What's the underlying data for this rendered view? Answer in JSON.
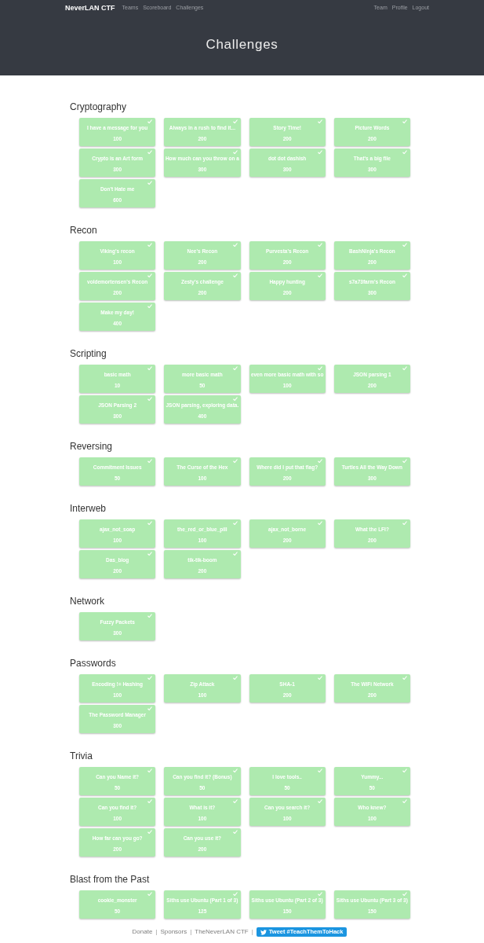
{
  "navbar": {
    "brand": "NeverLAN CTF",
    "left_links": [
      "Teams",
      "Scoreboard",
      "Challenges"
    ],
    "right_links": [
      "Team",
      "Profile",
      "Logout"
    ]
  },
  "header": {
    "title": "Challenges"
  },
  "categories": [
    {
      "name": "Cryptography",
      "challenges": [
        {
          "title": "I have a message for you",
          "points": "100",
          "solved": true
        },
        {
          "title": "Always in a rush to find it...",
          "points": "200",
          "solved": true
        },
        {
          "title": "Story Time!",
          "points": "200",
          "solved": true
        },
        {
          "title": "Picture Words",
          "points": "200",
          "solved": true
        },
        {
          "title": "Crypto is an Art form",
          "points": "300",
          "solved": true
        },
        {
          "title": "How much can you throw on a",
          "points": "300",
          "solved": true
        },
        {
          "title": "dot dot dashish",
          "points": "300",
          "solved": true
        },
        {
          "title": "That's a big file",
          "points": "300",
          "solved": true
        },
        {
          "title": "Don't Hate me",
          "points": "600",
          "solved": true
        }
      ]
    },
    {
      "name": "Recon",
      "challenges": [
        {
          "title": "Viking's recon",
          "points": "100",
          "solved": true
        },
        {
          "title": "Nee's Recon",
          "points": "200",
          "solved": true
        },
        {
          "title": "Purvesta's Recon",
          "points": "200",
          "solved": true
        },
        {
          "title": "BashNinja's Recon",
          "points": "200",
          "solved": true
        },
        {
          "title": "voldemortensen's Recon",
          "points": "200",
          "solved": true
        },
        {
          "title": "Zesty's challenge",
          "points": "200",
          "solved": true
        },
        {
          "title": "Happy hunting",
          "points": "200",
          "solved": true
        },
        {
          "title": "s7a73farm's Recon",
          "points": "300",
          "solved": true
        },
        {
          "title": "Make my day!",
          "points": "400",
          "solved": true
        }
      ]
    },
    {
      "name": "Scripting",
      "challenges": [
        {
          "title": "basic math",
          "points": "10",
          "solved": true
        },
        {
          "title": "more basic math",
          "points": "50",
          "solved": true
        },
        {
          "title": "even more basic math with so",
          "points": "100",
          "solved": true
        },
        {
          "title": "JSON parsing 1",
          "points": "200",
          "solved": true
        },
        {
          "title": "JSON Parsing 2",
          "points": "300",
          "solved": true
        },
        {
          "title": "JSON parsing, exploring data.",
          "points": "400",
          "solved": true
        }
      ]
    },
    {
      "name": "Reversing",
      "challenges": [
        {
          "title": "Commitment Issues",
          "points": "50",
          "solved": true
        },
        {
          "title": "The Curse of the Hex",
          "points": "100",
          "solved": true
        },
        {
          "title": "Where did I put that flag?",
          "points": "200",
          "solved": true
        },
        {
          "title": "Turtles All the Way Down",
          "points": "300",
          "solved": true
        }
      ]
    },
    {
      "name": "Interweb",
      "challenges": [
        {
          "title": "ajax_not_soap",
          "points": "100",
          "solved": true
        },
        {
          "title": "the_red_or_blue_pill",
          "points": "100",
          "solved": true
        },
        {
          "title": "ajax_not_borne",
          "points": "200",
          "solved": true
        },
        {
          "title": "What the LFI?",
          "points": "200",
          "solved": true
        },
        {
          "title": "Das_blog",
          "points": "200",
          "solved": true
        },
        {
          "title": "tik-tik-boom",
          "points": "200",
          "solved": true
        }
      ]
    },
    {
      "name": "Network",
      "challenges": [
        {
          "title": "Fuzzy Packets",
          "points": "300",
          "solved": true
        }
      ]
    },
    {
      "name": "Passwords",
      "challenges": [
        {
          "title": "Encoding != Hashing",
          "points": "100",
          "solved": true
        },
        {
          "title": "Zip Attack",
          "points": "100",
          "solved": true
        },
        {
          "title": "SHA-1",
          "points": "200",
          "solved": true
        },
        {
          "title": "The WiFi Network",
          "points": "200",
          "solved": true
        },
        {
          "title": "The Password Manager",
          "points": "300",
          "solved": true
        }
      ]
    },
    {
      "name": "Trivia",
      "challenges": [
        {
          "title": "Can you Name it?",
          "points": "50",
          "solved": true
        },
        {
          "title": "Can you find it? (Bonus)",
          "points": "50",
          "solved": true
        },
        {
          "title": "I love tools..",
          "points": "50",
          "solved": true
        },
        {
          "title": "Yummy...",
          "points": "50",
          "solved": true
        },
        {
          "title": "Can you find it?",
          "points": "100",
          "solved": true
        },
        {
          "title": "What is it?",
          "points": "100",
          "solved": true
        },
        {
          "title": "Can you search it?",
          "points": "100",
          "solved": true
        },
        {
          "title": "Who knew?",
          "points": "100",
          "solved": true
        },
        {
          "title": "How far can you go?",
          "points": "200",
          "solved": true
        },
        {
          "title": "Can you use it?",
          "points": "200",
          "solved": true
        }
      ]
    },
    {
      "name": "Blast from the Past",
      "challenges": [
        {
          "title": "cookie_monster",
          "points": "50",
          "solved": true
        },
        {
          "title": "Siths use Ubuntu (Part 1 of 3)",
          "points": "125",
          "solved": true
        },
        {
          "title": "Siths use Ubuntu (Part 2 of 3)",
          "points": "150",
          "solved": true
        },
        {
          "title": "Siths use Ubuntu (Part 3 of 3)",
          "points": "150",
          "solved": true
        }
      ]
    }
  ],
  "footer": {
    "items": [
      {
        "kind": "link",
        "text": "Donate"
      },
      {
        "kind": "separator",
        "text": "|"
      },
      {
        "kind": "link",
        "text": "Sponsors"
      },
      {
        "kind": "separator",
        "text": "|"
      },
      {
        "kind": "link",
        "text": "TheNeverLAN CTF"
      },
      {
        "kind": "separator",
        "text": "|"
      }
    ],
    "tweet_button": "Tweet #TeachThemToHack"
  }
}
